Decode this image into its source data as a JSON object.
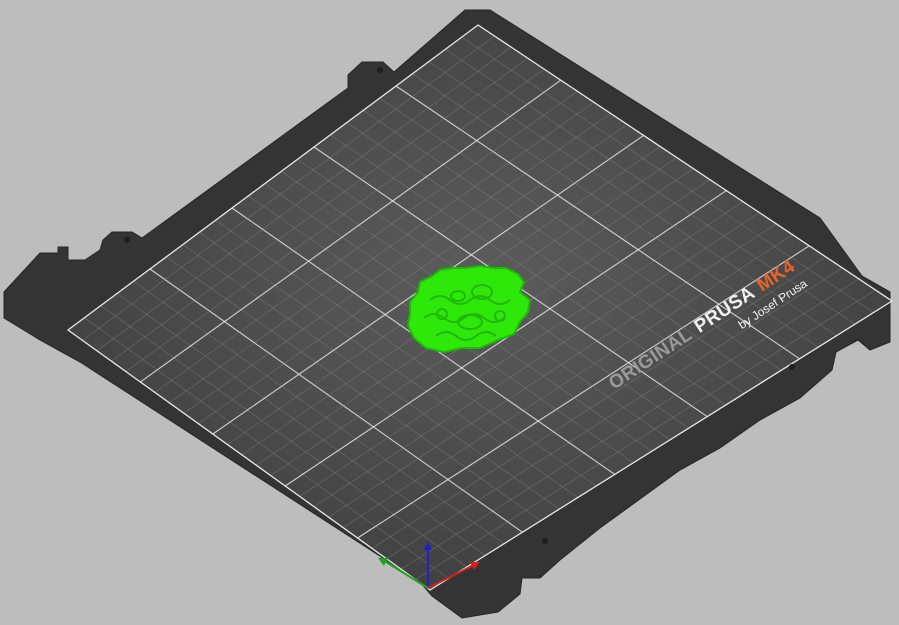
{
  "viewport": {
    "background_color": "#bdbdbd"
  },
  "bed": {
    "plate_color": "#3a3a3a",
    "sheet_color": "#474747",
    "grid_major_color": "#e8e8e8",
    "grid_minor_color": "#8a8a8a",
    "logo": {
      "line1_part1": "ORIGINAL",
      "line1_part2": "PRUSA",
      "line1_part3": "MK4",
      "line2": "by Josef Prusa",
      "gray_color": "#9a9a9a",
      "white_color": "#f2f2f2",
      "accent_color": "#e8652a"
    }
  },
  "model": {
    "color": "#2ee80a",
    "shade_color": "#1fb808"
  },
  "axes": {
    "x_color": "#d22020",
    "y_color": "#20a020",
    "z_color": "#2020c8"
  }
}
